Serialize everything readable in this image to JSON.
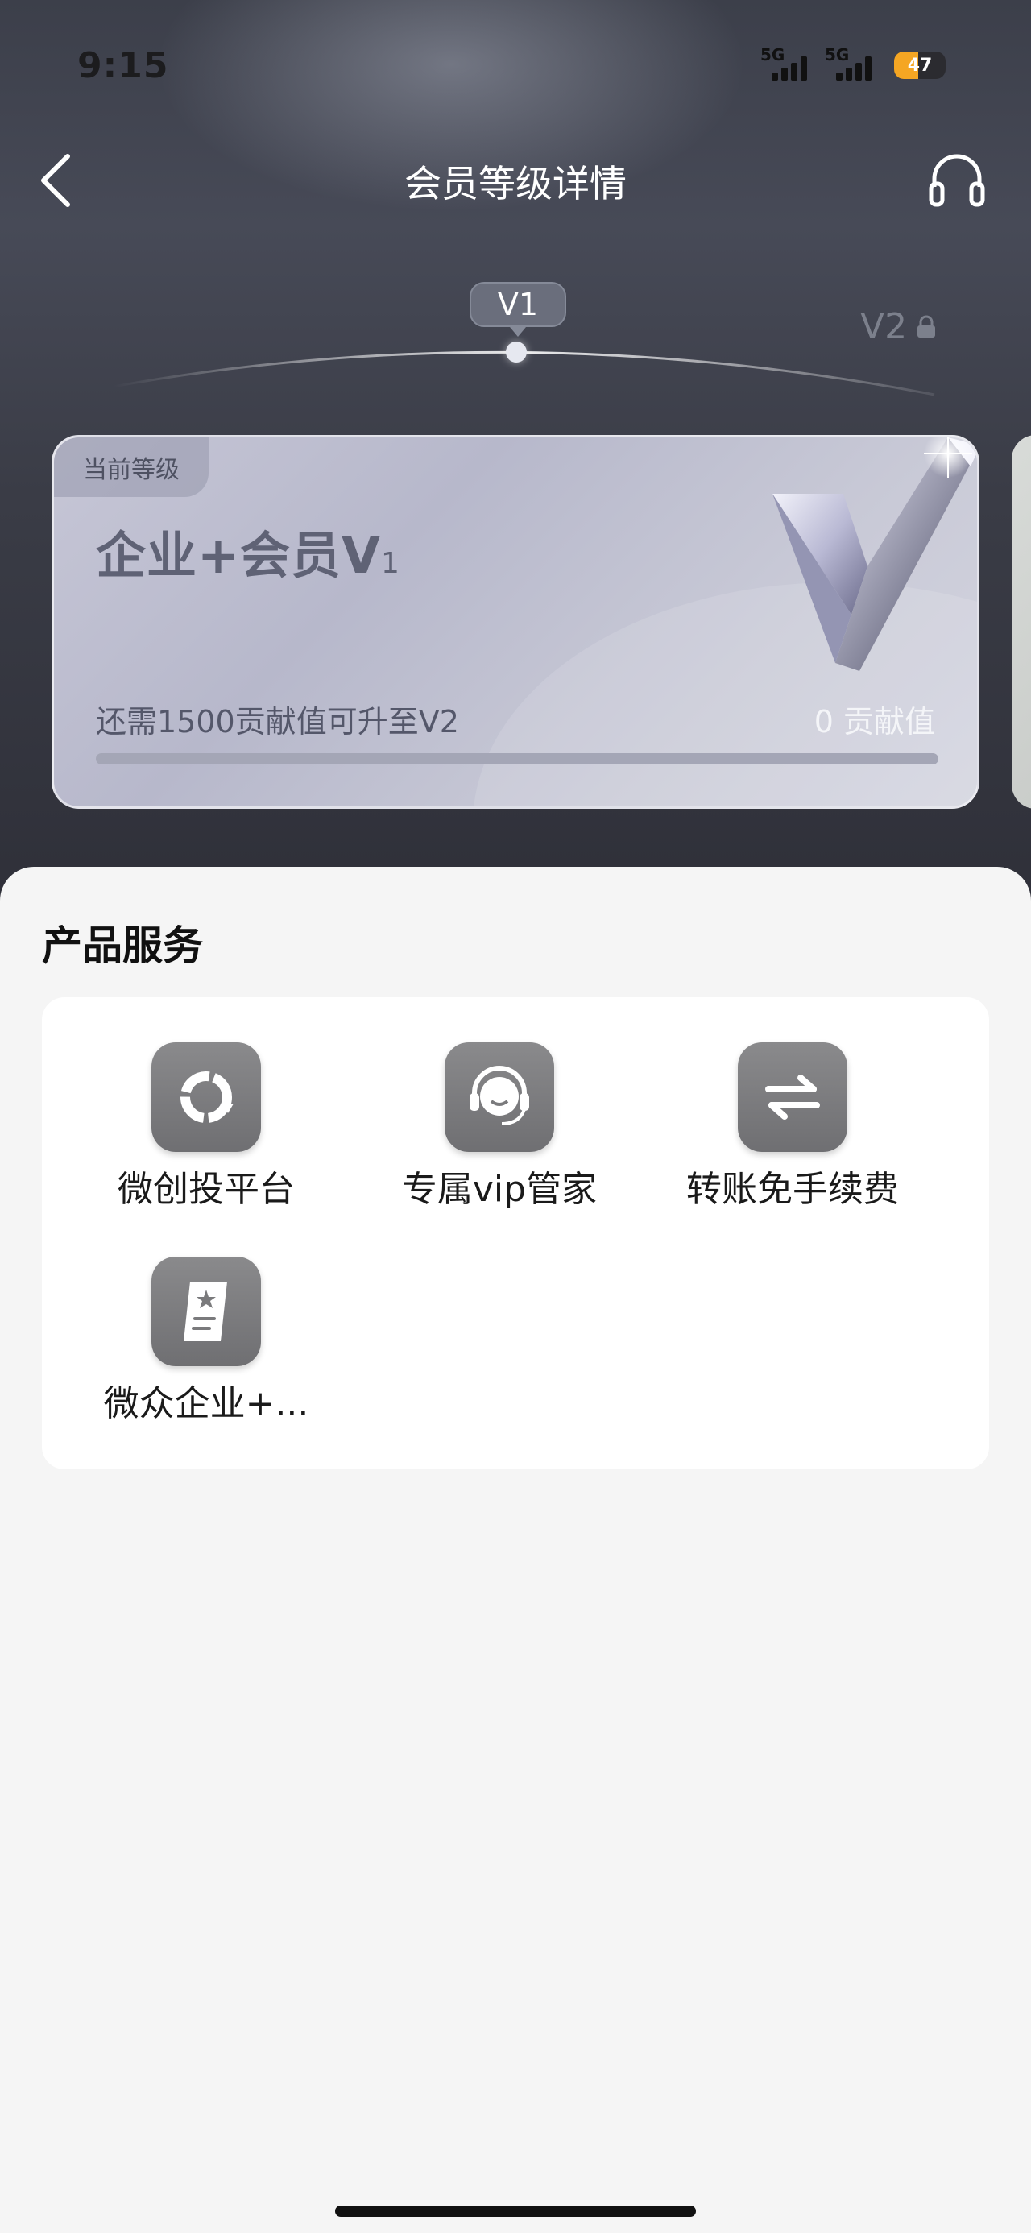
{
  "status_bar": {
    "time": "9:15",
    "network_1": "5G",
    "network_2": "5G",
    "battery": "47",
    "battery_level": 0.47
  },
  "header": {
    "title": "会员等级详情",
    "back_icon": "chevron-left-icon",
    "service_icon": "headset-icon"
  },
  "level_track": {
    "current": "V1",
    "next": "V2"
  },
  "member_card": {
    "tag": "当前等级",
    "title_prefix": "企业+会员",
    "level_letter": "V",
    "level_number": "1",
    "requirement": "还需1500贡献值可升至V2",
    "points": "0 贡献值",
    "progress": 0
  },
  "services": {
    "section_title": "产品服务",
    "items": [
      {
        "label": "微创投平台",
        "icon": "cycle-icon"
      },
      {
        "label": "专属vip管家",
        "icon": "headset-agent-icon"
      },
      {
        "label": "转账免手续费",
        "icon": "transfer-arrows-icon"
      },
      {
        "label": "微众企业+...",
        "icon": "certificate-icon"
      }
    ]
  },
  "colors": {
    "hero_bg": "#3c3f4a",
    "card_bg": "#c6c6d6",
    "icon_bg": "#7a7a7c"
  }
}
